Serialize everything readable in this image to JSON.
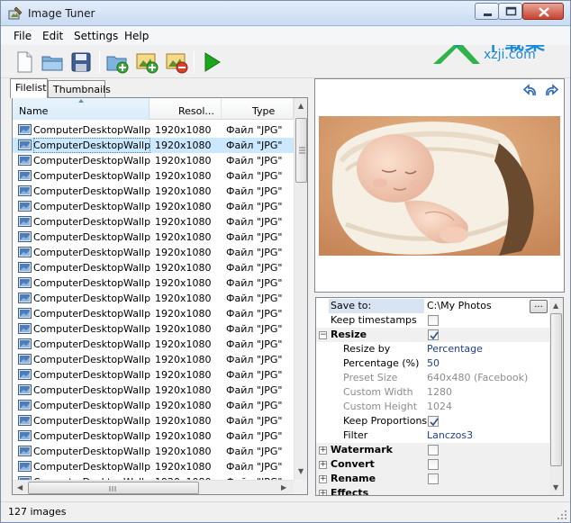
{
  "window": {
    "title": "Image Tuner",
    "watermark_cn": "下载集",
    "watermark_url": "xzji.com"
  },
  "menu": [
    "File",
    "Edit",
    "Settings",
    "Help"
  ],
  "toolbar": {
    "icons": [
      "new-file-icon",
      "open-folder-icon",
      "save-icon",
      "add-folder-icon",
      "add-images-icon",
      "remove-images-icon",
      "run-icon"
    ]
  },
  "tabs": [
    {
      "label": "Filelist",
      "active": true
    },
    {
      "label": "Thumbnails",
      "active": false
    }
  ],
  "filelist": {
    "columns": [
      "Name",
      "Resol...",
      "Type"
    ],
    "rows": [
      {
        "name": "ComputerDesktopWallp...",
        "res": "1920x1080",
        "type": "Файл \"JPG\"",
        "selected": false
      },
      {
        "name": "ComputerDesktopWallp...",
        "res": "1920x1080",
        "type": "Файл \"JPG\"",
        "selected": true
      },
      {
        "name": "ComputerDesktopWallp...",
        "res": "1920x1080",
        "type": "Файл \"JPG\"",
        "selected": false
      },
      {
        "name": "ComputerDesktopWallp...",
        "res": "1920x1080",
        "type": "Файл \"JPG\"",
        "selected": false
      },
      {
        "name": "ComputerDesktopWallp...",
        "res": "1920x1080",
        "type": "Файл \"JPG\"",
        "selected": false
      },
      {
        "name": "ComputerDesktopWallp...",
        "res": "1920x1080",
        "type": "Файл \"JPG\"",
        "selected": false
      },
      {
        "name": "ComputerDesktopWallp...",
        "res": "1920x1080",
        "type": "Файл \"JPG\"",
        "selected": false
      },
      {
        "name": "ComputerDesktopWallp...",
        "res": "1920x1080",
        "type": "Файл \"JPG\"",
        "selected": false
      },
      {
        "name": "ComputerDesktopWallp...",
        "res": "1920x1080",
        "type": "Файл \"JPG\"",
        "selected": false
      },
      {
        "name": "ComputerDesktopWallp...",
        "res": "1920x1080",
        "type": "Файл \"JPG\"",
        "selected": false
      },
      {
        "name": "ComputerDesktopWallp...",
        "res": "1920x1080",
        "type": "Файл \"JPG\"",
        "selected": false
      },
      {
        "name": "ComputerDesktopWallp...",
        "res": "1920x1080",
        "type": "Файл \"JPG\"",
        "selected": false
      },
      {
        "name": "ComputerDesktopWallp...",
        "res": "1920x1080",
        "type": "Файл \"JPG\"",
        "selected": false
      },
      {
        "name": "ComputerDesktopWallp...",
        "res": "1920x1080",
        "type": "Файл \"JPG\"",
        "selected": false
      },
      {
        "name": "ComputerDesktopWallp...",
        "res": "1920x1080",
        "type": "Файл \"JPG\"",
        "selected": false
      },
      {
        "name": "ComputerDesktopWallp...",
        "res": "1920x1080",
        "type": "Файл \"JPG\"",
        "selected": false
      },
      {
        "name": "ComputerDesktopWallp...",
        "res": "1920x1080",
        "type": "Файл \"JPG\"",
        "selected": false
      },
      {
        "name": "ComputerDesktopWallp...",
        "res": "1920x1080",
        "type": "Файл \"JPG\"",
        "selected": false
      },
      {
        "name": "ComputerDesktopWallp...",
        "res": "1920x1080",
        "type": "Файл \"JPG\"",
        "selected": false
      },
      {
        "name": "ComputerDesktopWallp...",
        "res": "1920x1080",
        "type": "Файл \"JPG\"",
        "selected": false
      },
      {
        "name": "ComputerDesktopWallp...",
        "res": "1920x1080",
        "type": "Файл \"JPG\"",
        "selected": false
      },
      {
        "name": "ComputerDesktopWallp...",
        "res": "1920x1080",
        "type": "Файл \"JPG\"",
        "selected": false
      },
      {
        "name": "ComputerDesktopWallp...",
        "res": "1920x1080",
        "type": "Файл \"JPG\"",
        "selected": false
      },
      {
        "name": "ComputerDesktopWallp...",
        "res": "1920x1080",
        "type": "Файл \"JPG\"",
        "selected": false
      }
    ]
  },
  "props": {
    "save_to_label": "Save to:",
    "save_to_value": "C:\\My Photos",
    "browse_label": "...",
    "keep_timestamps_label": "Keep timestamps",
    "resize": {
      "label": "Resize",
      "checked": true,
      "expander": "−",
      "resize_by_label": "Resize by",
      "resize_by_value": "Percentage",
      "percentage_label": "Percentage (%)",
      "percentage_value": "50",
      "preset_size_label": "Preset Size",
      "preset_size_value": "640x480 (Facebook)",
      "custom_width_label": "Custom Width",
      "custom_width_value": "1280",
      "custom_height_label": "Custom Height",
      "custom_height_value": "1024",
      "keep_proportions_label": "Keep Proportions",
      "keep_proportions_checked": true,
      "filter_label": "Filter",
      "filter_value": "Lanczos3"
    },
    "watermark_label": "Watermark",
    "convert_label": "Convert",
    "rename_label": "Rename",
    "effects_label": "Effects",
    "collapsed_expander": "+"
  },
  "status": {
    "text": "127 images"
  },
  "colors": {
    "selection": "#cce8ff",
    "value_blue": "#1d3f8f",
    "disabled_gray": "#8c8c8c",
    "run_green": "#1ea51e"
  }
}
